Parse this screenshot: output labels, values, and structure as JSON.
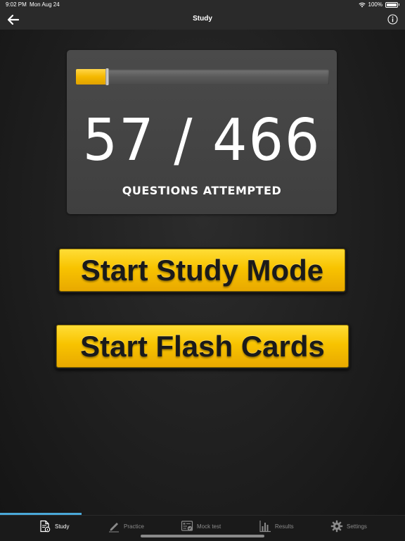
{
  "status_bar": {
    "time": "9:02 PM",
    "date": "Mon Aug 24",
    "battery": "100%"
  },
  "nav": {
    "title": "Study",
    "back_icon": "arrow-left-icon",
    "info_icon": "info-icon"
  },
  "progress": {
    "attempted": 57,
    "total": 466,
    "count_text": "57 / 466",
    "label": "QUESTIONS ATTEMPTED",
    "fraction": 0.1223
  },
  "actions": {
    "study_mode_label": "Start Study Mode",
    "flash_cards_label": "Start Flash Cards"
  },
  "tabs": [
    {
      "label": "Study",
      "icon": "document-icon",
      "active": true
    },
    {
      "label": "Practice",
      "icon": "pencil-icon",
      "active": false
    },
    {
      "label": "Mock test",
      "icon": "test-icon",
      "active": false
    },
    {
      "label": "Results",
      "icon": "bar-chart-icon",
      "active": false
    },
    {
      "label": "Settings",
      "icon": "gear-icon",
      "active": false
    }
  ],
  "colors": {
    "accent_yellow": "#f8c300",
    "tab_active_indicator": "#4aa8d8",
    "background": "#1e1e1e",
    "card": "#454545"
  }
}
